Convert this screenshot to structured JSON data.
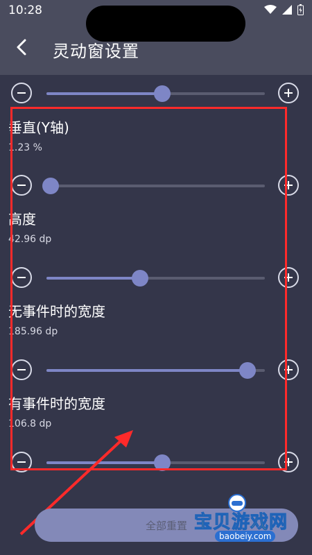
{
  "status": {
    "time": "10:28"
  },
  "header": {
    "title": "灵动窗设置"
  },
  "settings": [
    {
      "label": "垂直(Y轴)",
      "value": "1.23 %",
      "fraction": 0.02
    },
    {
      "label": "高度",
      "value": "42.96 dp",
      "fraction": 0.43
    },
    {
      "label": "无事件时的宽度",
      "value": "185.96 dp",
      "fraction": 0.92
    },
    {
      "label": "有事件时的宽度",
      "value": "106.8 dp",
      "fraction": 0.53
    }
  ],
  "top_slider": {
    "fraction": 0.53
  },
  "reset_button": {
    "label": "全部重置"
  },
  "watermark": {
    "main": "宝贝游戏网",
    "sub": "baobeiy.com"
  },
  "colors": {
    "accent": "#7e86c6",
    "annotation": "#ff2a2a"
  }
}
